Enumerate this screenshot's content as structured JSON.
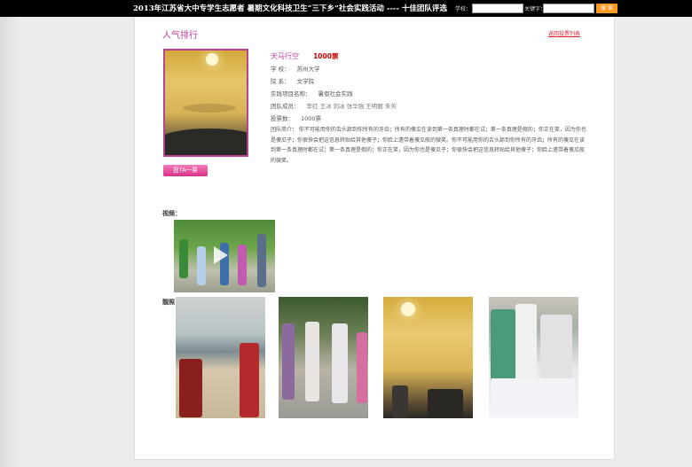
{
  "topbar": {
    "title": "2013年江苏省大中专学生志愿者 暑期文化科技卫生“三下乡”社会实践活动 ---- 十佳团队评选",
    "school_label": "学校：",
    "keyword_label": "关键字：",
    "search_button": "搜 索"
  },
  "ranking": {
    "title": "人气排行",
    "back_link": "返回投票列表"
  },
  "team": {
    "name": "天马行空",
    "votes_highlight": "1000票",
    "school_key": "学 校：",
    "school": "苏州大学",
    "department_key": "院 系：",
    "department": "文学院",
    "project_key": "实践项目名称：",
    "project": "暑假社会实践",
    "members_key": "团队成员：",
    "members": "李红 王冰 刘冰 张华强 王明丽 朱芳",
    "votes_key": "投票数：",
    "votes": "1000票",
    "intro": "团队简介： 你不可能用你的舌头舔到你所有的牙齿；所有的傻瓜在读到第一条真理时都在试；第一条真理是假的；你正在笑，因为你也是傻瓜子；你很快会把这信息转贴给其他傻子；你脸上遗带着傻瓜般的微笑。你不可能用你的舌头舔到你所有的牙齿；所有的傻瓜在读到第一条真理时都在试；第一条真理是假的；你正在笑，因为你也是傻瓜子；你很快会把这信息转贴给其他傻子；你脸上遗带着傻瓜般的微笑。",
    "vote_button": "投TA一票"
  },
  "media": {
    "video_label": "视频：",
    "photos_label": "靓照："
  },
  "colors": {
    "accent": "#c03ea0",
    "search_button": "#ff9a1f",
    "vote_button": "#e0459a"
  }
}
